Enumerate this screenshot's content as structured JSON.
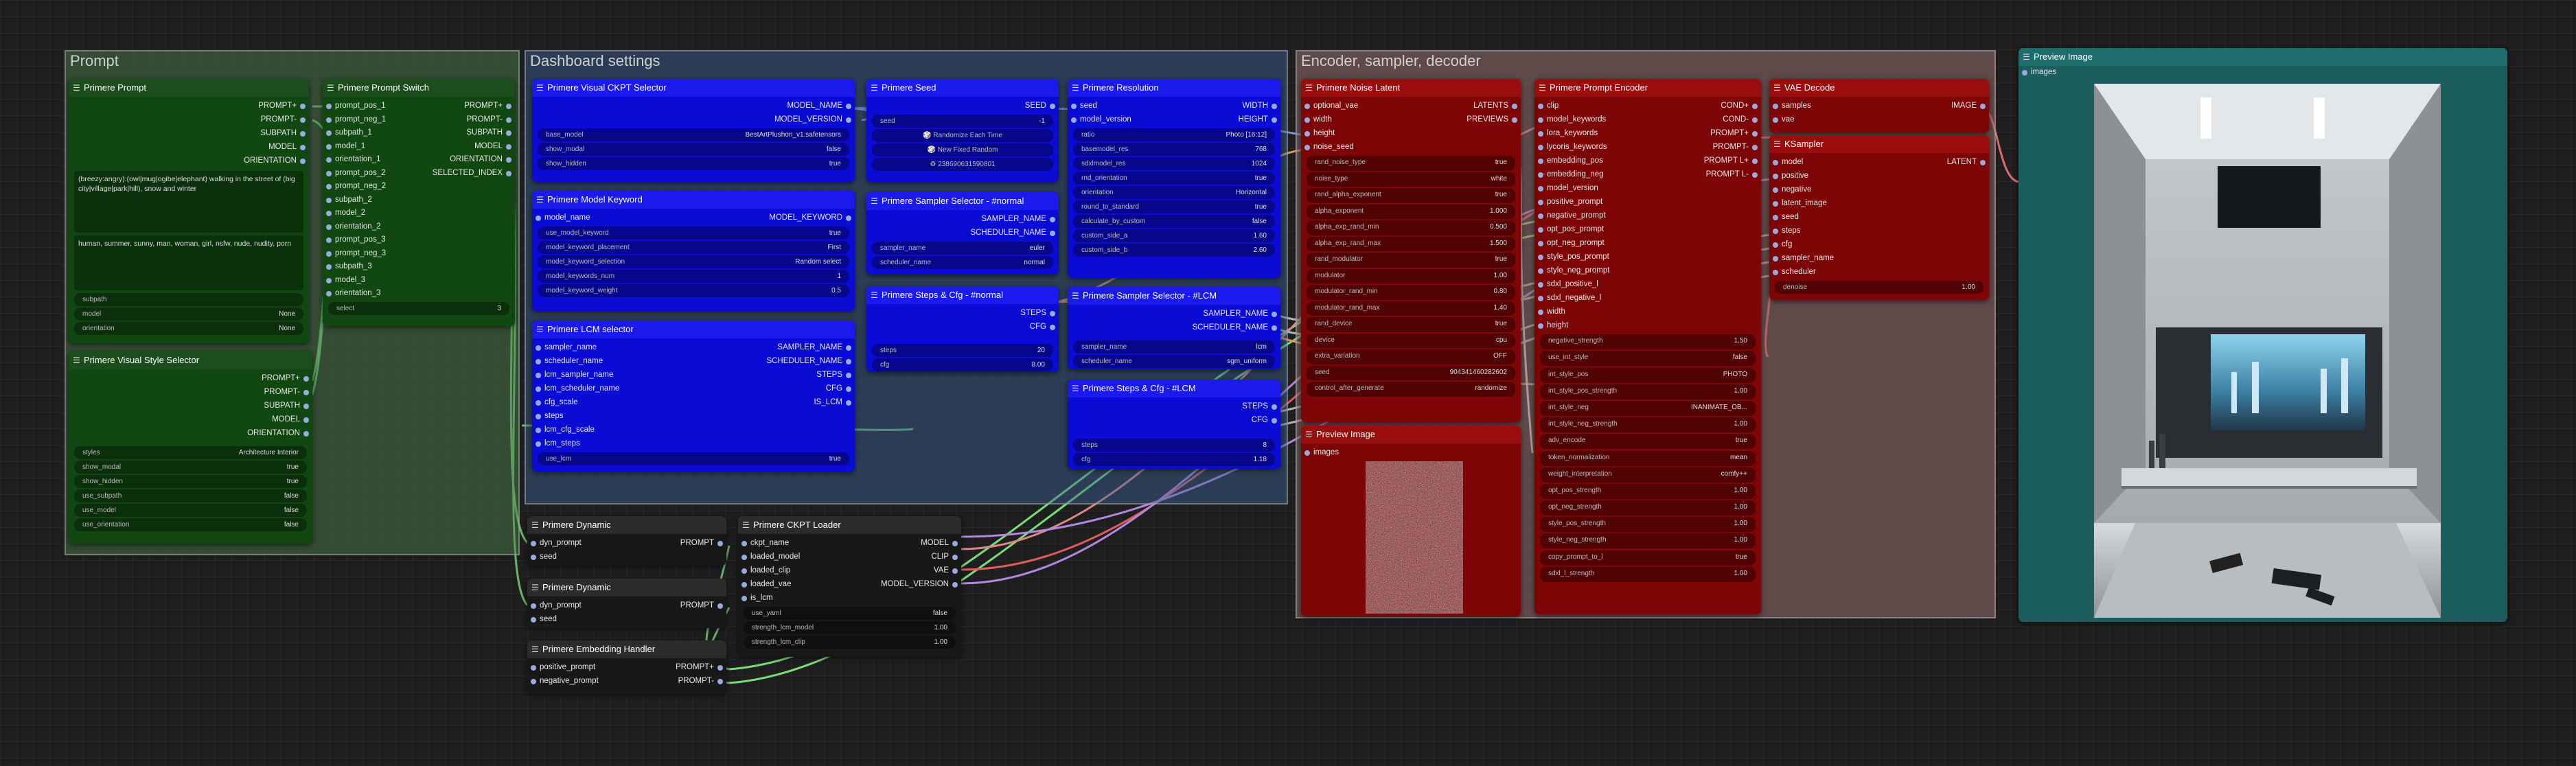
{
  "groups": {
    "prompt": "Prompt",
    "dashboard": "Dashboard settings",
    "encoder": "Encoder, sampler, decoder"
  },
  "prompt_node": {
    "title": "Primere Prompt",
    "outputs": [
      "PROMPT+",
      "PROMPT-",
      "SUBPATH",
      "MODEL",
      "ORIENTATION"
    ],
    "positive_text": "(breezy:angry):(owl|mug|ogibe|elephant) walking in the street of (big city|village|park|hill), snow and winter",
    "negative_text": "human, summer, sunny, man, woman, girl, nsfw, nude, nudity, porn",
    "widgets": [
      {
        "l": "subpath",
        "v": ""
      },
      {
        "l": "model",
        "v": "None"
      },
      {
        "l": "orientation",
        "v": "None"
      }
    ]
  },
  "switch_node": {
    "title": "Primere Prompt Switch",
    "inputs": [
      "prompt_pos_1",
      "prompt_neg_1",
      "subpath_1",
      "model_1",
      "orientation_1",
      "prompt_pos_2",
      "prompt_neg_2",
      "subpath_2",
      "model_2",
      "orientation_2",
      "prompt_pos_3",
      "prompt_neg_3",
      "subpath_3",
      "model_3",
      "orientation_3"
    ],
    "outputs": [
      "PROMPT+",
      "PROMPT-",
      "SUBPATH",
      "MODEL",
      "ORIENTATION",
      "SELECTED_INDEX"
    ],
    "widgets": [
      {
        "l": "select",
        "v": "3"
      }
    ]
  },
  "style_node": {
    "title": "Primere Visual Style Selector",
    "outputs": [
      "PROMPT+",
      "PROMPT-",
      "SUBPATH",
      "MODEL",
      "ORIENTATION"
    ],
    "widgets": [
      {
        "l": "styles",
        "v": "Architecture Interior"
      },
      {
        "l": "show_modal",
        "v": "true"
      },
      {
        "l": "show_hidden",
        "v": "true"
      },
      {
        "l": "use_subpath",
        "v": "false"
      },
      {
        "l": "use_model",
        "v": "false"
      },
      {
        "l": "use_orientation",
        "v": "false"
      }
    ]
  },
  "ckpt_selector": {
    "title": "Primere Visual CKPT Selector",
    "outputs": [
      "MODEL_NAME",
      "MODEL_VERSION"
    ],
    "widgets": [
      {
        "l": "base_model",
        "v": "BestArtPlushon_v1.safetensors"
      },
      {
        "l": "show_modal",
        "v": "false"
      },
      {
        "l": "show_hidden",
        "v": "true"
      }
    ]
  },
  "model_keyword": {
    "title": "Primere Model Keyword",
    "inputs": [
      "model_name"
    ],
    "outputs": [
      "MODEL_KEYWORD"
    ],
    "widgets": [
      {
        "l": "use_model_keyword",
        "v": "true"
      },
      {
        "l": "model_keyword_placement",
        "v": "First"
      },
      {
        "l": "model_keyword_selection",
        "v": "Random select"
      },
      {
        "l": "model_keywords_num",
        "v": "1"
      },
      {
        "l": "model_keyword_weight",
        "v": "0.5"
      }
    ]
  },
  "lcm_selector": {
    "title": "Primere LCM selector",
    "inputs": [
      "sampler_name",
      "scheduler_name",
      "lcm_sampler_name",
      "lcm_scheduler_name",
      "cfg_scale",
      "steps",
      "lcm_cfg_scale",
      "lcm_steps"
    ],
    "outputs": [
      "SAMPLER_NAME",
      "SCHEDULER_NAME",
      "STEPS",
      "CFG",
      "IS_LCM"
    ],
    "widgets": [
      {
        "l": "use_lcm",
        "v": "true"
      }
    ]
  },
  "seed": {
    "title": "Primere Seed",
    "outputs": [
      "SEED"
    ],
    "widgets": [
      {
        "l": "seed",
        "v": "-1"
      }
    ],
    "buttons": [
      "🎲 Randomize Each Time",
      "🎲 New Fixed Random",
      "♻ 238690631590801"
    ]
  },
  "resolution": {
    "title": "Primere Resolution",
    "inputs": [
      "seed",
      "model_version"
    ],
    "outputs": [
      "WIDTH",
      "HEIGHT"
    ],
    "widgets": [
      {
        "l": "ratio",
        "v": "Photo [16:12]"
      },
      {
        "l": "basemodel_res",
        "v": "768"
      },
      {
        "l": "sdxlmodel_res",
        "v": "1024"
      },
      {
        "l": "rnd_orientation",
        "v": "true"
      },
      {
        "l": "orientation",
        "v": "Horizontal"
      },
      {
        "l": "round_to_standard",
        "v": "true"
      },
      {
        "l": "calculate_by_custom",
        "v": "false"
      },
      {
        "l": "custom_side_a",
        "v": "1.60"
      },
      {
        "l": "custom_side_b",
        "v": "2.60"
      }
    ]
  },
  "sampler_normal": {
    "title": "Primere Sampler Selector - #normal",
    "outputs": [
      "SAMPLER_NAME",
      "SCHEDULER_NAME"
    ],
    "widgets": [
      {
        "l": "sampler_name",
        "v": "euler"
      },
      {
        "l": "scheduler_name",
        "v": "normal"
      }
    ]
  },
  "steps_normal": {
    "title": "Primere Steps & Cfg - #normal",
    "outputs": [
      "STEPS",
      "CFG"
    ],
    "widgets": [
      {
        "l": "steps",
        "v": "20"
      },
      {
        "l": "cfg",
        "v": "8.00"
      }
    ]
  },
  "sampler_lcm": {
    "title": "Primere Sampler Selector - #LCM",
    "outputs": [
      "SAMPLER_NAME",
      "SCHEDULER_NAME"
    ],
    "widgets": [
      {
        "l": "sampler_name",
        "v": "lcm"
      },
      {
        "l": "scheduler_name",
        "v": "sgm_uniform"
      }
    ]
  },
  "steps_lcm": {
    "title": "Primere Steps & Cfg - #LCM",
    "outputs": [
      "STEPS",
      "CFG"
    ],
    "widgets": [
      {
        "l": "steps",
        "v": "8"
      },
      {
        "l": "cfg",
        "v": "1.18"
      }
    ]
  },
  "dyn1": {
    "title": "Primere Dynamic",
    "inputs": [
      "dyn_prompt",
      "seed"
    ],
    "outputs": [
      "PROMPT"
    ]
  },
  "dyn2": {
    "title": "Primere Dynamic",
    "inputs": [
      "dyn_prompt",
      "seed"
    ],
    "outputs": [
      "PROMPT"
    ]
  },
  "embedding": {
    "title": "Primere Embedding Handler",
    "inputs": [
      "positive_prompt",
      "negative_prompt"
    ],
    "outputs": [
      "PROMPT+",
      "PROMPT-"
    ]
  },
  "ckpt_loader": {
    "title": "Primere CKPT Loader",
    "inputs": [
      "ckpt_name",
      "loaded_model",
      "loaded_clip",
      "loaded_vae",
      "is_lcm"
    ],
    "outputs": [
      "MODEL",
      "CLIP",
      "VAE",
      "MODEL_VERSION"
    ],
    "widgets": [
      {
        "l": "use_yaml",
        "v": "false"
      },
      {
        "l": "strength_lcm_model",
        "v": "1.00"
      },
      {
        "l": "strength_lcm_clip",
        "v": "1.00"
      }
    ]
  },
  "noise_latent": {
    "title": "Primere Noise Latent",
    "inputs": [
      "optional_vae",
      "width",
      "height",
      "noise_seed"
    ],
    "outputs": [
      "LATENTS",
      "PREVIEWS"
    ],
    "widgets": [
      {
        "l": "rand_noise_type",
        "v": "true"
      },
      {
        "l": "noise_type",
        "v": "white"
      },
      {
        "l": "rand_alpha_exponent",
        "v": "true"
      },
      {
        "l": "alpha_exponent",
        "v": "1.000"
      },
      {
        "l": "alpha_exp_rand_min",
        "v": "0.500"
      },
      {
        "l": "alpha_exp_rand_max",
        "v": "1.500"
      },
      {
        "l": "rand_modulator",
        "v": "true"
      },
      {
        "l": "modulator",
        "v": "1.00"
      },
      {
        "l": "modulator_rand_min",
        "v": "0.80"
      },
      {
        "l": "modulator_rand_max",
        "v": "1.40"
      },
      {
        "l": "rand_device",
        "v": "true"
      },
      {
        "l": "device",
        "v": "cpu"
      },
      {
        "l": "extra_variation",
        "v": "OFF"
      },
      {
        "l": "seed",
        "v": "904341460282602"
      },
      {
        "l": "control_after_generate",
        "v": "randomize"
      }
    ]
  },
  "prompt_encoder": {
    "title": "Primere Prompt Encoder",
    "inputs": [
      "clip",
      "model_keywords",
      "lora_keywords",
      "lycoris_keywords",
      "embedding_pos",
      "embedding_neg",
      "model_version",
      "positive_prompt",
      "negative_prompt",
      "opt_pos_prompt",
      "opt_neg_prompt",
      "style_pos_prompt",
      "style_neg_prompt",
      "sdxl_positive_l",
      "sdxl_negative_l",
      "width",
      "height"
    ],
    "outputs": [
      "COND+",
      "COND-",
      "PROMPT+",
      "PROMPT-",
      "PROMPT L+",
      "PROMPT L-"
    ],
    "widgets": [
      {
        "l": "negative_strength",
        "v": "1.50"
      },
      {
        "l": "use_int_style",
        "v": "false"
      },
      {
        "l": "int_style_pos",
        "v": "PHOTO"
      },
      {
        "l": "int_style_pos_strength",
        "v": "1.00"
      },
      {
        "l": "int_style_neg",
        "v": "INANIMATE_OB..."
      },
      {
        "l": "int_style_neg_strength",
        "v": "1.00"
      },
      {
        "l": "adv_encode",
        "v": "true"
      },
      {
        "l": "token_normalization",
        "v": "mean"
      },
      {
        "l": "weight_interpretation",
        "v": "comfy++"
      },
      {
        "l": "opt_pos_strength",
        "v": "1.00"
      },
      {
        "l": "opt_neg_strength",
        "v": "1.00"
      },
      {
        "l": "style_pos_strength",
        "v": "1.00"
      },
      {
        "l": "style_neg_strength",
        "v": "1.00"
      },
      {
        "l": "copy_prompt_to_l",
        "v": "true"
      },
      {
        "l": "sdxl_l_strength",
        "v": "1.00"
      }
    ]
  },
  "vae_decode": {
    "title": "VAE Decode",
    "inputs": [
      "samples",
      "vae"
    ],
    "outputs": [
      "IMAGE"
    ]
  },
  "ksampler": {
    "title": "KSampler",
    "inputs": [
      "model",
      "positive",
      "negative",
      "latent_image",
      "seed",
      "steps",
      "cfg",
      "sampler_name",
      "scheduler"
    ],
    "outputs": [
      "LATENT"
    ],
    "widgets": [
      {
        "l": "denoise",
        "v": "1.00"
      }
    ]
  },
  "preview_small": {
    "title": "Preview Image",
    "inputs": [
      "images"
    ]
  },
  "preview_big": {
    "title": "Preview Image",
    "inputs": [
      "images"
    ]
  }
}
